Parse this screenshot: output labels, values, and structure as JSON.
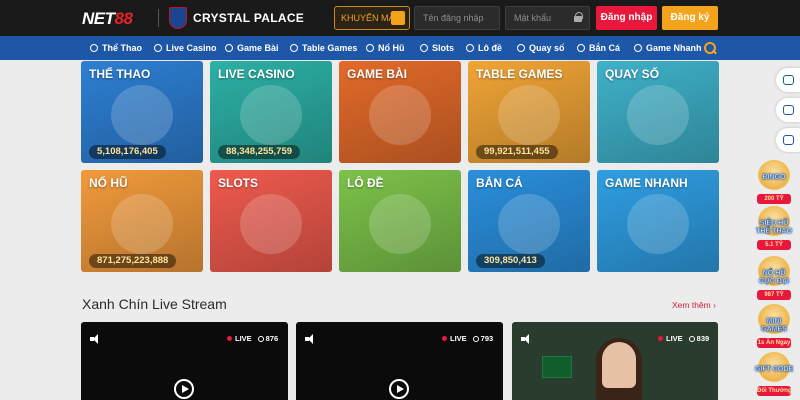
{
  "header": {
    "logo_prefix": "NET",
    "logo_number": "88",
    "partner_name": "CRYSTAL PALACE",
    "promo_label": "KHUYẾN MÃI",
    "username_placeholder": "Tên đăng nhập",
    "password_placeholder": "Mật khẩu",
    "login_label": "Đăng nhập",
    "register_label": "Đăng ký"
  },
  "nav": [
    {
      "label": "Thể Thao",
      "icon": "soccer-ball-icon"
    },
    {
      "label": "Live Casino",
      "icon": "live-casino-icon"
    },
    {
      "label": "Game Bài",
      "icon": "cards-icon"
    },
    {
      "label": "Table Games",
      "icon": "table-games-icon"
    },
    {
      "label": "Nổ Hũ",
      "icon": "slot-jar-icon"
    },
    {
      "label": "Slots",
      "icon": "slots-icon"
    },
    {
      "label": "Lô đề",
      "icon": "lottery-ball-icon"
    },
    {
      "label": "Quay số",
      "icon": "spin-wheel-icon"
    },
    {
      "label": "Bắn Cá",
      "icon": "fish-icon"
    },
    {
      "label": "Game Nhanh",
      "icon": "rocket-icon"
    }
  ],
  "games": [
    {
      "title": "THỂ THAO",
      "jackpot": "5,108,176,405",
      "color": "#2d7fd3",
      "art": "footballer-with-trophy"
    },
    {
      "title": "LIVE CASINO",
      "jackpot": "88,348,255,759",
      "color": "#2cb0a5",
      "art": "casino-dealer"
    },
    {
      "title": "GAME BÀI",
      "jackpot": "",
      "color": "#e36a2a",
      "art": "card-player"
    },
    {
      "title": "TABLE GAMES",
      "jackpot": "99,921,511,455",
      "color": "#f0a436",
      "art": "dice-and-chips"
    },
    {
      "title": "QUAY SỐ",
      "jackpot": "",
      "color": "#3fb1c9",
      "art": "lottery-cage"
    },
    {
      "title": "NỔ HŨ",
      "jackpot": "871,275,223,888",
      "color": "#f29a3b",
      "art": "fortune-god"
    },
    {
      "title": "SLOTS",
      "jackpot": "",
      "color": "#ef5a4d",
      "art": "lucky-777"
    },
    {
      "title": "LÔ ĐỀ",
      "jackpot": "",
      "color": "#7cc24a",
      "art": "lottery-balls"
    },
    {
      "title": "BẮN CÁ",
      "jackpot": "309,850,413",
      "color": "#2a8fdc",
      "art": "shark-gunner"
    },
    {
      "title": "GAME NHANH",
      "jackpot": "",
      "color": "#2f9ee3",
      "art": "airplane"
    }
  ],
  "live": {
    "section_title": "Xanh Chín Live Stream",
    "see_more_label": "Xem thêm",
    "live_label": "LIVE",
    "streams": [
      {
        "viewers": "876"
      },
      {
        "viewers": "793"
      },
      {
        "viewers": "839"
      }
    ]
  },
  "side_promos": [
    {
      "name": "BINGO",
      "prize": "200 TỶ"
    },
    {
      "name": "SIÊU HŨ THỂ THAO",
      "prize": "5.1 TỶ"
    },
    {
      "name": "NỔ HŨ CỰC ĐẠI",
      "prize": "987 TỶ"
    },
    {
      "name": "MINI GAMES",
      "prize": "1s Ăn Ngay"
    },
    {
      "name": "GIFT CODE",
      "prize": "Đổi Thưởng"
    }
  ],
  "colors": {
    "brand_red": "#e8173b",
    "accent_orange": "#f4a41c",
    "nav_blue": "#1e57a8",
    "header_dark": "#1a1a1a"
  }
}
